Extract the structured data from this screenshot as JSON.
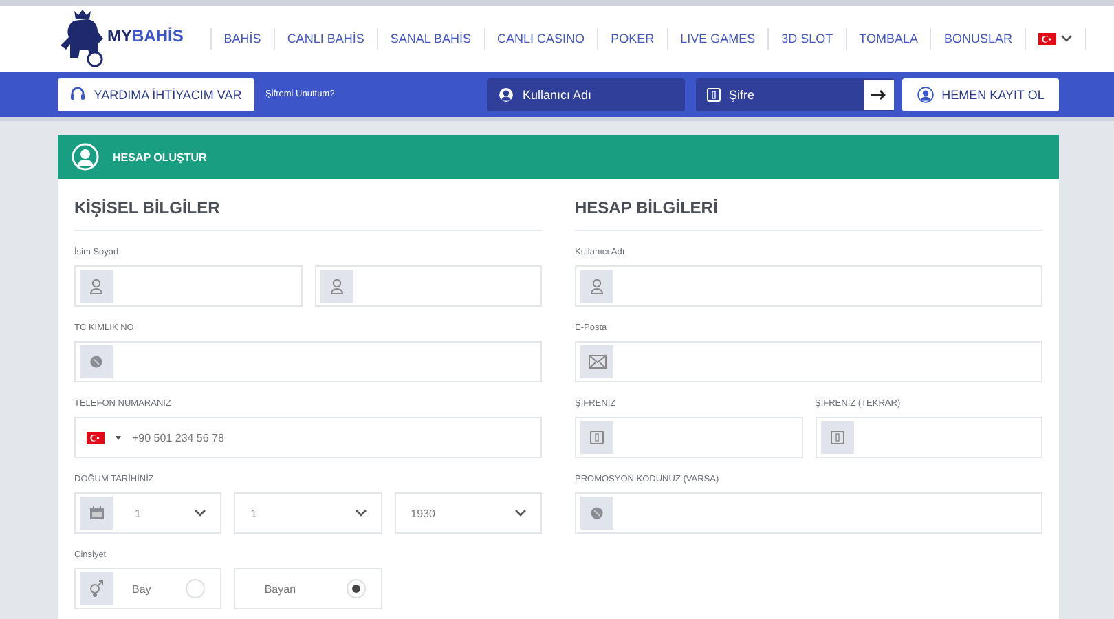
{
  "header": {
    "logo": {
      "first": "MY",
      "second": "BAHİS"
    },
    "nav": [
      "BAHİS",
      "CANLI BAHİS",
      "SANAL BAHİS",
      "CANLI CASINO",
      "POKER",
      "LIVE GAMES",
      "3D SLOT",
      "TOMBALA",
      "BONUSLAR"
    ]
  },
  "login_bar": {
    "help_button": "YARDIMA İHTİYACIM VAR",
    "forgot_link": "Şifremi Unuttum?",
    "username": {
      "placeholder": "Kullanıcı Adı"
    },
    "password": {
      "placeholder": "Şifre"
    },
    "register_button": "HEMEN KAYIT OL"
  },
  "form": {
    "title": "HESAP OLUŞTUR",
    "sections": [
      {
        "heading": "KİŞİSEL BİLGİLER",
        "rows": [
          {
            "label": "İsim Soyad",
            "fields": [
              {
                "kind": "user"
              },
              {
                "kind": "user"
              }
            ]
          },
          {
            "label": "TC KİMLİK NO",
            "fields": [
              {
                "kind": "id"
              }
            ]
          },
          {
            "label": "TELEFON NUMARANIZ",
            "fields": [
              {
                "kind": "phone",
                "placeholder": "+90 501 234 56 78"
              }
            ]
          },
          {
            "label": "DOĞUM TARİHİNİZ",
            "fields": [
              {
                "kind": "date-select",
                "value": "1"
              },
              {
                "kind": "select",
                "value": "1"
              },
              {
                "kind": "select",
                "value": "1930"
              }
            ]
          },
          {
            "label": "Cinsiyet",
            "fields": [
              {
                "kind": "gender-radio",
                "label": "Bay",
                "selected": false
              },
              {
                "kind": "radio",
                "label": "Bayan",
                "selected": true
              }
            ]
          }
        ]
      },
      {
        "heading": "HESAP BİLGİLERİ",
        "rows": [
          {
            "label": "Kullanıcı Adı",
            "fields": [
              {
                "kind": "user"
              }
            ]
          },
          {
            "label": "E-Posta",
            "fields": [
              {
                "kind": "mail"
              }
            ]
          },
          {
            "label": "ŞİFRENİZ",
            "fields": [
              {
                "kind": "password"
              }
            ],
            "second_label": "ŞİFRENİZ (TEKRAR)",
            "second_fields": [
              {
                "kind": "password"
              }
            ]
          },
          {
            "label": "PROMOSYON KODUNUZ (VARSA)",
            "fields": [
              {
                "kind": "id"
              }
            ]
          }
        ]
      }
    ]
  }
}
